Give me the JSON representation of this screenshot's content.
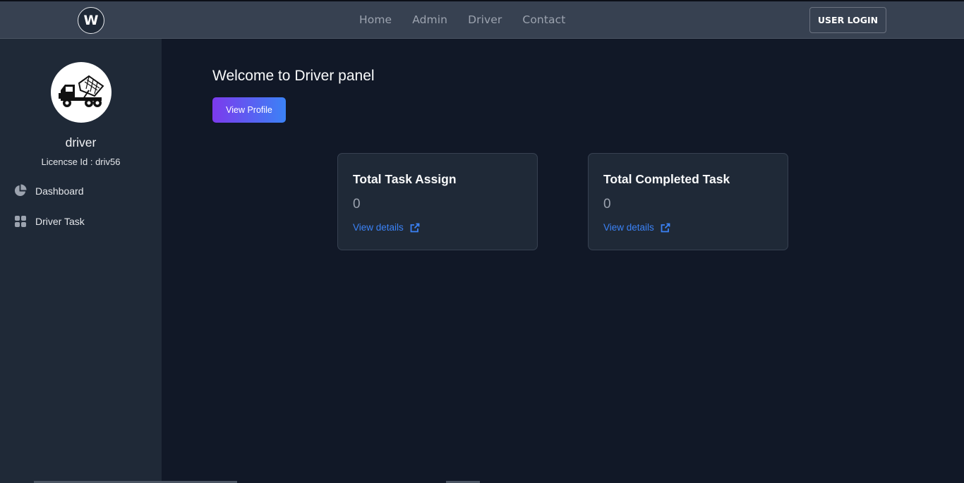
{
  "header": {
    "logo_text": "W",
    "nav": [
      "Home",
      "Admin",
      "Driver",
      "Contact"
    ],
    "login_label": "USER LOGIN"
  },
  "sidebar": {
    "avatar_icon": "dump-truck-icon",
    "name": "driver",
    "licence": "Licencse Id : driv56",
    "items": [
      {
        "label": "Dashboard",
        "icon": "pie-chart-icon"
      },
      {
        "label": "Driver Task",
        "icon": "grid-icon"
      }
    ]
  },
  "main": {
    "welcome": "Welcome to Driver panel",
    "profile_button": "View Profile",
    "cards": [
      {
        "title": "Total Task Assign",
        "value": "0",
        "link": "View details",
        "icon": "external-link-icon"
      },
      {
        "title": "Total Completed Task",
        "value": "0",
        "link": "View details",
        "icon": "external-link-icon"
      }
    ]
  },
  "colors": {
    "background": "#111827",
    "sidebar": "#1f2937",
    "topbar": "#374151",
    "link": "#3b82f6",
    "button_gradient_start": "#7c3aed",
    "button_gradient_end": "#3b82f6"
  }
}
